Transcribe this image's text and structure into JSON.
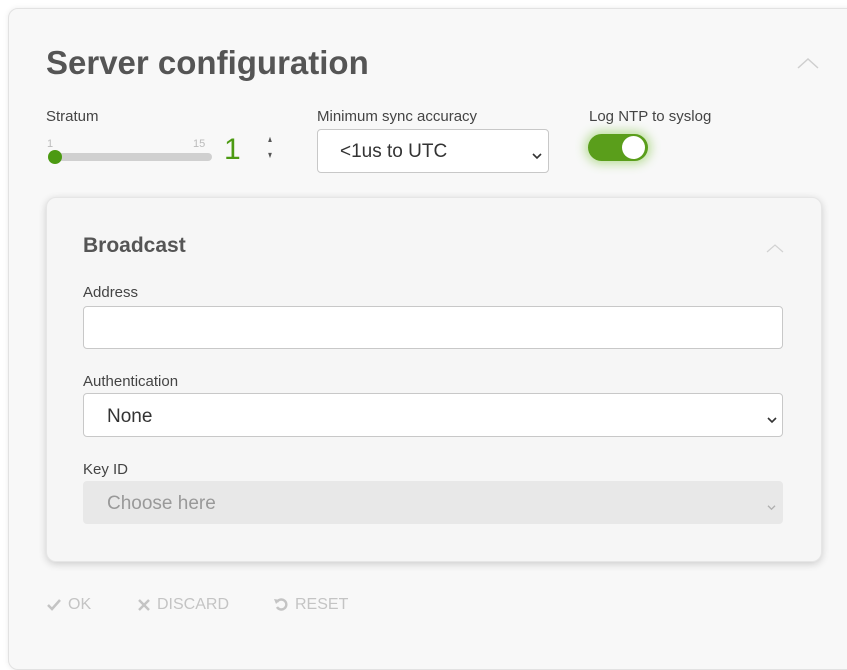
{
  "header": {
    "title": "Server configuration"
  },
  "stratum": {
    "label": "Stratum",
    "min_label": "1",
    "max_label": "15",
    "value": "1",
    "stepper_up": "▲",
    "stepper_down": "▼"
  },
  "sync_accuracy": {
    "label": "Minimum sync accuracy",
    "selected": "<1us to UTC"
  },
  "log_ntp": {
    "label": "Log NTP to syslog",
    "enabled": true
  },
  "broadcast": {
    "title": "Broadcast",
    "address_label": "Address",
    "address_value": "",
    "auth_label": "Authentication",
    "auth_selected": "None",
    "key_id_label": "Key ID",
    "key_id_placeholder": "Choose here"
  },
  "actions": {
    "ok": "OK",
    "discard": "DISCARD",
    "reset": "RESET"
  },
  "colors": {
    "accent": "#4c9a12",
    "disabled": "#c4c4c4"
  }
}
